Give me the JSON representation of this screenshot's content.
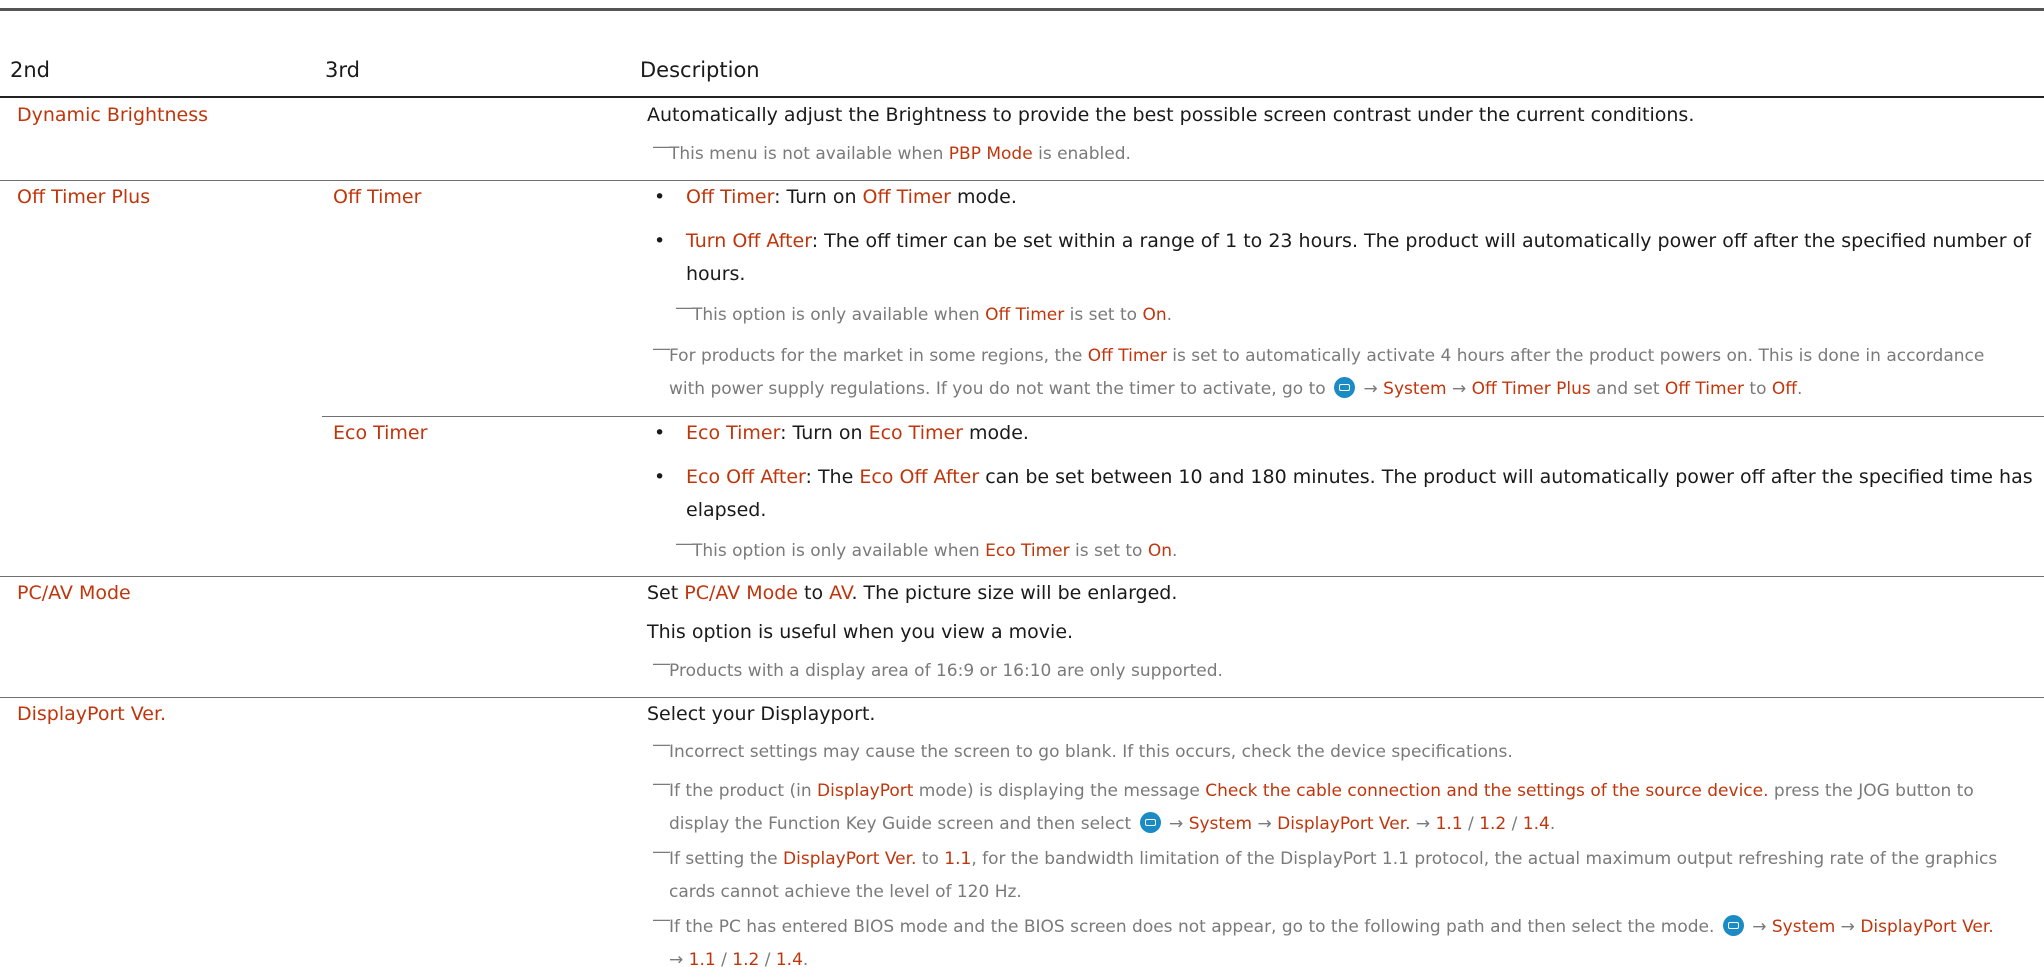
{
  "header": {
    "col2": "2nd",
    "col3": "3rd",
    "col_desc": "Description"
  },
  "icons": {
    "menu": "menu-icon"
  },
  "colors": {
    "highlight": "#c0360c",
    "note": "#7a7a7a",
    "text": "#1a1a1a",
    "icon": "#1a8bc4"
  },
  "note_mark": "―",
  "bullet_mark": "•",
  "rows": {
    "dynamic_brightness": {
      "label": "Dynamic Brightness",
      "desc": "Automatically adjust the Brightness to provide the best possible screen contrast under the current conditions.",
      "note_a": "This menu is not available when ",
      "note_b": "PBP Mode",
      "note_c": " is enabled."
    },
    "off_timer_plus": {
      "label": "Off Timer Plus",
      "off_timer": {
        "label": "Off Timer",
        "b1_term": "Off Timer",
        "b1_a": ": Turn on ",
        "b1_b": "Off Timer",
        "b1_c": " mode.",
        "b2_term": "Turn Off After",
        "b2_line1": ": The off timer can be set within a range of 1 to 23 hours. The product will automatically power off after the specified number of",
        "b2_line2": "hours.",
        "note1_a": "This option is only available when ",
        "note1_b": "Off Timer",
        "note1_c": " is set to ",
        "note1_d": "On",
        "note1_e": ".",
        "note2_a": "For products for the market in some regions, the ",
        "note2_b": "Off Timer",
        "note2_c": " is set to automatically activate 4 hours after the product powers on. This is done in accordance",
        "note2_d": "with power supply regulations. If you do not want the timer to activate, go to ",
        "note2_e": " → ",
        "note2_f": "System",
        "note2_g": " → ",
        "note2_h": "Off Timer Plus",
        "note2_i": " and set ",
        "note2_j": "Off Timer",
        "note2_k": " to ",
        "note2_l": "Off",
        "note2_m": "."
      },
      "eco_timer": {
        "label": "Eco Timer",
        "b1_term": "Eco Timer",
        "b1_a": ": Turn on ",
        "b1_b": "Eco Timer",
        "b1_c": " mode.",
        "b2_term": "Eco Off After",
        "b2_a": ": The ",
        "b2_b": "Eco Off After",
        "b2_c": " can be set between 10 and 180 minutes. The product will automatically power off after the specified time has",
        "b2_line2": "elapsed.",
        "note_a": "This option is only available when ",
        "note_b": "Eco Timer",
        "note_c": " is set to ",
        "note_d": "On",
        "note_e": "."
      }
    },
    "pc_av_mode": {
      "label": "PC/AV Mode",
      "l1_a": "Set ",
      "l1_b": "PC/AV Mode",
      "l1_c": " to ",
      "l1_d": "AV",
      "l1_e": ". The picture size will be enlarged.",
      "l2": "This option is useful when you view a movie.",
      "note": "Products with a display area of 16:9 or 16:10 are only supported."
    },
    "displayport_ver": {
      "label": "DisplayPort Ver.",
      "l1": "Select your Displayport.",
      "n1": "Incorrect settings may cause the screen to go blank. If this occurs, check the device specifications.",
      "n2_a": "If the product (in ",
      "n2_b": "DisplayPort",
      "n2_c": " mode) is displaying the message ",
      "n2_d": "Check the cable connection and the settings of the source device.",
      "n2_e": " press the JOG button to",
      "n2_f": "display the Function Key Guide screen and then select ",
      "n2_g": " → ",
      "n2_h": "System",
      "n2_i": " → ",
      "n2_j": "DisplayPort Ver.",
      "n2_k": " → ",
      "n2_l": "1.1",
      "n2_m": " / ",
      "n2_n": "1.2",
      "n2_o": " / ",
      "n2_p": "1.4",
      "n2_q": ".",
      "n3_a": "If setting the ",
      "n3_b": "DisplayPort Ver.",
      "n3_c": " to ",
      "n3_d": "1.1",
      "n3_e": ", for the bandwidth limitation of the DisplayPort 1.1 protocol, the actual maximum output refreshing rate of the graphics",
      "n3_f": "cards cannot achieve the level of 120 Hz.",
      "n4_a": "If the PC has entered BIOS mode and the BIOS screen does not appear, go to the following path and then select the mode. ",
      "n4_b": " → ",
      "n4_c": "System",
      "n4_d": " → ",
      "n4_e": "DisplayPort Ver.",
      "n4_f": "→ ",
      "n4_g": "1.1",
      "n4_h": " / ",
      "n4_i": "1.2",
      "n4_j": " / ",
      "n4_k": "1.4",
      "n4_l": "."
    }
  }
}
